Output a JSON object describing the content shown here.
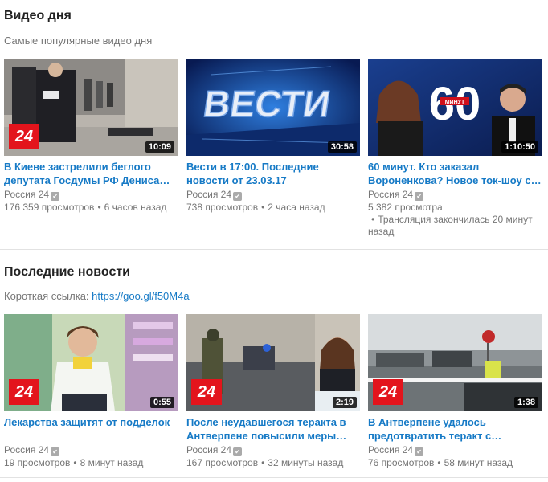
{
  "sections": [
    {
      "title": "Видео дня",
      "subtitle": "Самые популярные видео дня",
      "videos": [
        {
          "title": "В Киеве застрелили беглого депутата Госдумы РФ Дениса Вороненкова",
          "duration": "10:09",
          "channel": "Россия 24",
          "views": "176 359 просмотров",
          "age": "6 часов назад"
        },
        {
          "title": "Вести в 17:00. Последние новости от 23.03.17",
          "duration": "30:58",
          "channel": "Россия 24",
          "views": "738 просмотров",
          "age": "2 часа назад"
        },
        {
          "title": "60 минут. Кто заказал Вороненкова? Новое ток-шоу с Ольгой Скабеевой",
          "duration": "1:10:50",
          "channel": "Россия 24",
          "views": "5 382 просмотра",
          "age": "Трансляция закончилась 20 минут назад"
        }
      ]
    },
    {
      "title": "Последние новости",
      "subtitle_prefix": "Короткая ссылка: ",
      "subtitle_link": "https://goo.gl/f50M4a",
      "videos": [
        {
          "title": "Лекарства защитят от подделок",
          "duration": "0:55",
          "channel": "Россия 24",
          "views": "19 просмотров",
          "age": "8 минут назад"
        },
        {
          "title": "После неудавшегося теракта в Антверпене повысили меры безопасности",
          "duration": "2:19",
          "channel": "Россия 24",
          "views": "167 просмотров",
          "age": "32 минуты назад"
        },
        {
          "title": "В Антверпене удалось предотвратить теракт с автомобилем",
          "duration": "1:38",
          "channel": "Россия 24",
          "views": "76 просмотров",
          "age": "58 минут назад"
        }
      ]
    }
  ],
  "thumb_overlays": {
    "logo_24": "24",
    "vesti_text": "ВЕСТИ",
    "sixty_text": "60",
    "minutes_text": "МИНУТ"
  },
  "verified_icon": "check-icon",
  "colors": {
    "link": "#167ac6",
    "meta": "#767676",
    "logo_red": "#e3141c"
  }
}
